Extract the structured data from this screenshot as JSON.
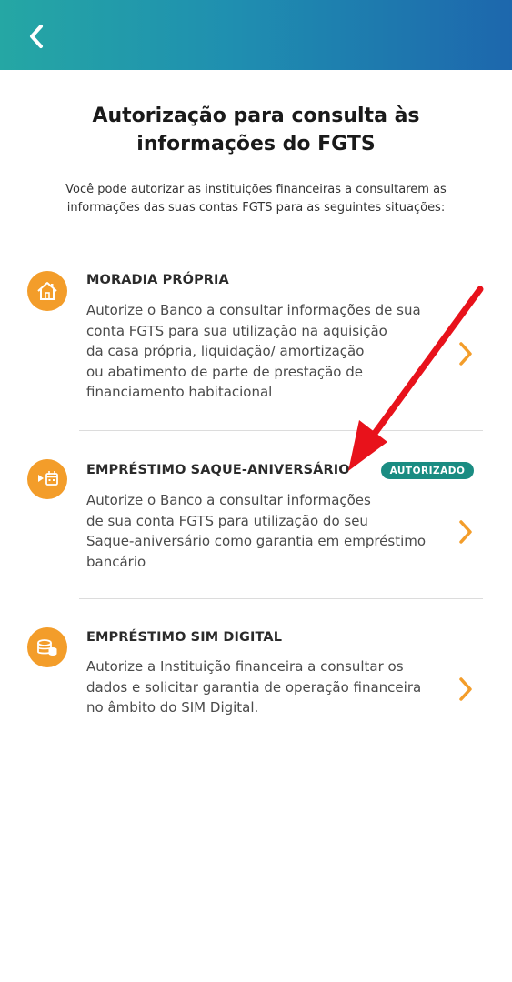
{
  "header": {
    "back_icon": "chevron-left-icon",
    "gradient_colors": [
      "#25a7a4",
      "#1d67ad"
    ]
  },
  "page": {
    "title": "Autorização para consulta às informações do FGTS",
    "subtitle": "Você pode autorizar as instituições financeiras a consultarem as informações das suas contas FGTS para as seguintes situações:"
  },
  "items": [
    {
      "icon": "house-icon",
      "title": "MORADIA PRÓPRIA",
      "description": [
        "Autorize o Banco a consultar informações de sua",
        "conta FGTS para sua utilização na aquisição",
        "da casa própria, liquidação/ amortização",
        "ou abatimento de parte de prestação de",
        "financiamento habitacional"
      ]
    },
    {
      "icon": "calendar-play-icon",
      "title": "EMPRÉSTIMO SAQUE-ANIVERSÁRIO",
      "badge": "AUTORIZADO",
      "description": [
        "Autorize o Banco a consultar informações",
        "de sua conta FGTS para utilização do seu",
        "Saque-aniversário como garantia em empréstimo",
        "bancário"
      ]
    },
    {
      "icon": "coins-icon",
      "title": "EMPRÉSTIMO SIM DIGITAL",
      "description": [
        "Autorize a Instituição financeira a consultar os",
        "dados e solicitar garantia de operação financeira",
        "no âmbito do SIM Digital."
      ]
    }
  ],
  "colors": {
    "accent_orange": "#f39d2a",
    "badge_teal": "#1a8c82",
    "annotation_red": "#e8121b"
  }
}
